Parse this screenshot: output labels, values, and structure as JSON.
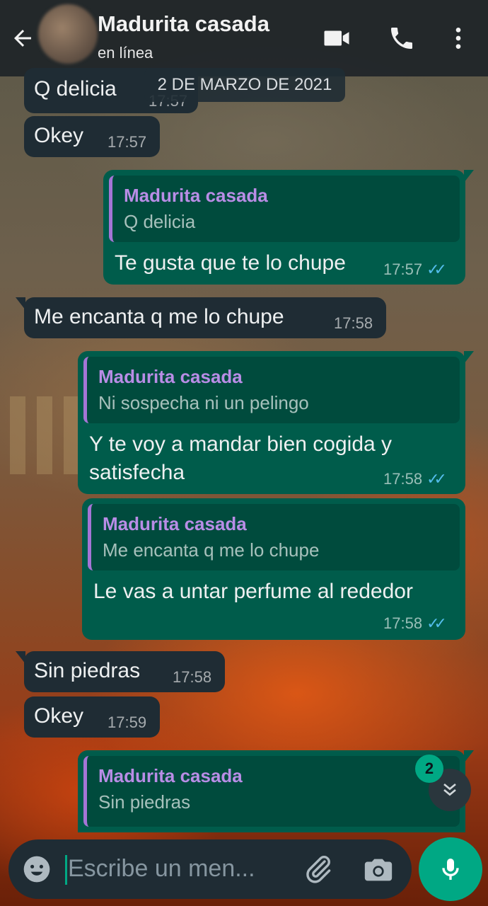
{
  "header": {
    "contact_name": "Madurita casada",
    "status": "en línea"
  },
  "date_chip": "2 DE MARZO DE 2021",
  "messages": [
    {
      "text": "Q delicia",
      "time": "17:57"
    },
    {
      "text": "Okey",
      "time": "17:57"
    },
    {
      "quote_name": "Madurita casada",
      "quote_text": "Q delicia",
      "text": "Te gusta que te lo chupe",
      "time": "17:57"
    },
    {
      "text": "Me encanta q me lo chupe",
      "time": "17:58"
    },
    {
      "quote_name": "Madurita casada",
      "quote_text": "Ni sospecha ni un pelingo",
      "text": "Y te voy a mandar bien cogida y satisfecha",
      "time": "17:58"
    },
    {
      "quote_name": "Madurita casada",
      "quote_text": "Me encanta q me lo chupe",
      "text": "Le vas a untar perfume al rededor",
      "time": "17:58"
    },
    {
      "text": "Sin piedras",
      "time": "17:58"
    },
    {
      "text": "Okey",
      "time": "17:59"
    },
    {
      "quote_name": "Madurita casada",
      "quote_text": "Sin piedras"
    }
  ],
  "unread_count": "2",
  "composer": {
    "placeholder": "Escribe un men..."
  },
  "icons": {
    "back": "arrow-left-icon",
    "video": "video-call-icon",
    "call": "phone-icon",
    "menu": "more-vert-icon",
    "emoji": "emoji-icon",
    "attach": "paperclip-icon",
    "camera": "camera-icon",
    "mic": "microphone-icon",
    "scroll": "double-chevron-down-icon"
  },
  "colors": {
    "header": "#1e2428",
    "incoming_bubble": "#1f2c34",
    "outgoing_bubble": "#005c4b",
    "quote_name": "#b98de6",
    "read_ticks": "#53bdeb",
    "accent": "#00a884"
  }
}
